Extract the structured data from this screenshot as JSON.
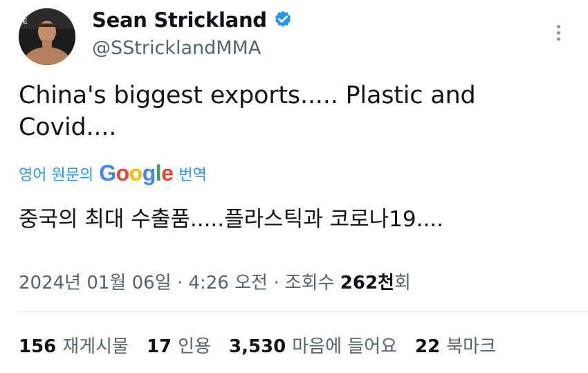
{
  "author": {
    "display_name": "Sean Strickland",
    "handle": "@SStricklandMMA",
    "verified": true
  },
  "tweet": {
    "text": "China's biggest exports..... Plastic and Covid....",
    "translate_prefix": "영어 원문의",
    "translate_brand": "Google",
    "translate_suffix": "번역",
    "translated_text": "중국의 최대 수출품.....플라스틱과 코로나19...."
  },
  "meta": {
    "date": "2024년 01월 06일",
    "time": "4:26 오전",
    "views_prefix": "조회수",
    "views_number": "262천",
    "views_suffix": "회",
    "separator": "·"
  },
  "stats": [
    {
      "value": "156",
      "label": "재게시물"
    },
    {
      "value": "17",
      "label": "인용"
    },
    {
      "value": "3,530",
      "label": "마음에 들어요"
    },
    {
      "value": "22",
      "label": "북마크"
    }
  ],
  "colors": {
    "link": "#1d9bf0",
    "secondary_text": "#536471",
    "primary_text": "#0f1419"
  }
}
